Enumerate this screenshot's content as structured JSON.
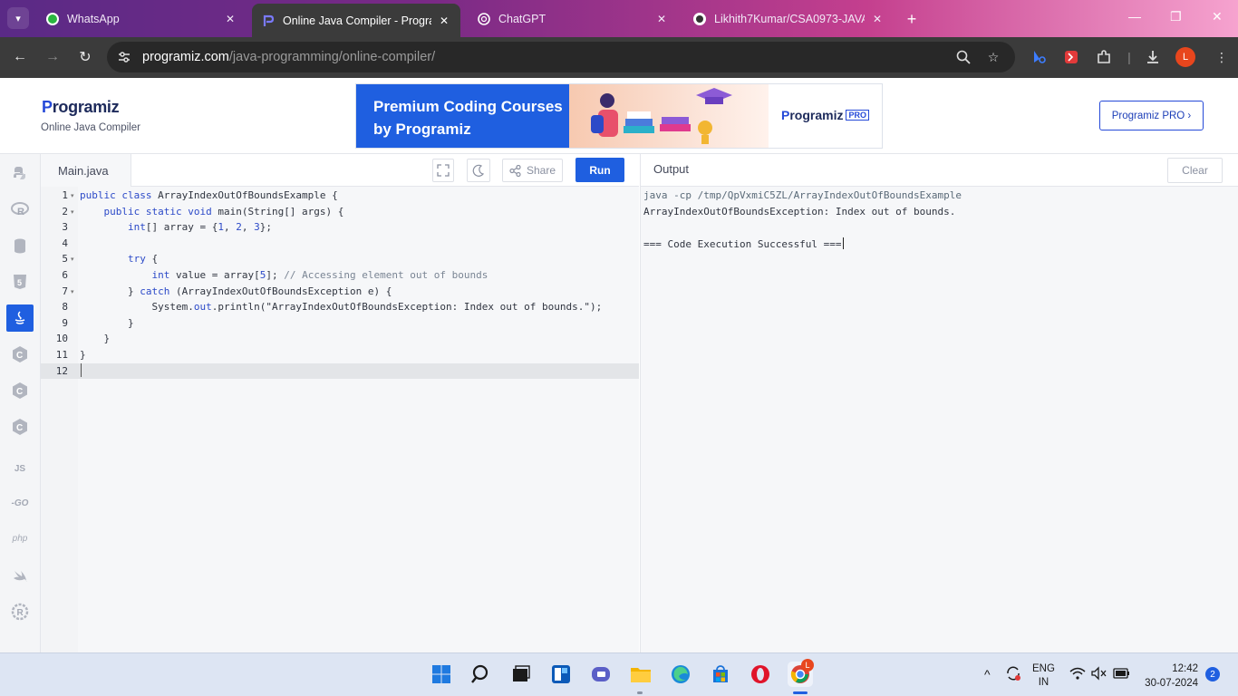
{
  "browser": {
    "tabs": [
      {
        "label": "WhatsApp",
        "icon": "whatsapp-icon"
      },
      {
        "label": "Online Java Compiler - Program",
        "icon": "programiz-icon",
        "active": true
      },
      {
        "label": "ChatGPT",
        "icon": "chatgpt-icon"
      },
      {
        "label": "Likhith7Kumar/CSA0973-JAVA",
        "icon": "github-icon"
      }
    ],
    "url_host": "programiz.com",
    "url_path": "/java-programming/online-compiler/",
    "profile_initial": "L"
  },
  "site": {
    "logo_first": "P",
    "logo_rest": "rogramiz",
    "logo_sub": "Online Java Compiler",
    "banner_title": "Premium Coding Courses by Programiz",
    "banner_logo_first": "P",
    "banner_logo_rest": "rogramiz",
    "banner_pro": "PRO",
    "pro_button": "Programiz PRO ›"
  },
  "rail": [
    {
      "name": "python-icon",
      "label": ""
    },
    {
      "name": "r-lang-icon",
      "label": "R"
    },
    {
      "name": "sql-icon",
      "label": ""
    },
    {
      "name": "html-icon",
      "label": "5"
    },
    {
      "name": "java-icon",
      "label": "",
      "active": true
    },
    {
      "name": "c-icon",
      "label": "C"
    },
    {
      "name": "cpp-icon",
      "label": "C"
    },
    {
      "name": "csharp-icon",
      "label": "C"
    },
    {
      "name": "js-icon",
      "label": "JS"
    },
    {
      "name": "go-icon",
      "label": "-GO"
    },
    {
      "name": "php-icon",
      "label": "php"
    },
    {
      "name": "swift-icon",
      "label": ""
    },
    {
      "name": "rust-icon",
      "label": "R"
    }
  ],
  "editor": {
    "file_tab": "Main.java",
    "share_label": "Share",
    "run_label": "Run",
    "line_numbers": [
      "1",
      "2",
      "3",
      "4",
      "5",
      "6",
      "7",
      "8",
      "9",
      "10",
      "11",
      "12"
    ]
  },
  "output": {
    "title": "Output",
    "clear_label": "Clear",
    "lines": [
      "java -cp /tmp/QpVxmiC5ZL/ArrayIndexOutOfBoundsExample",
      "ArrayIndexOutOfBoundsException: Index out of bounds.",
      "",
      "=== Code Execution Successful ==="
    ]
  },
  "taskbar": {
    "lang_top": "ENG",
    "lang_bottom": "IN",
    "time": "12:42",
    "date": "30-07-2024",
    "notification_count": "2",
    "chrome_badge": "L"
  }
}
